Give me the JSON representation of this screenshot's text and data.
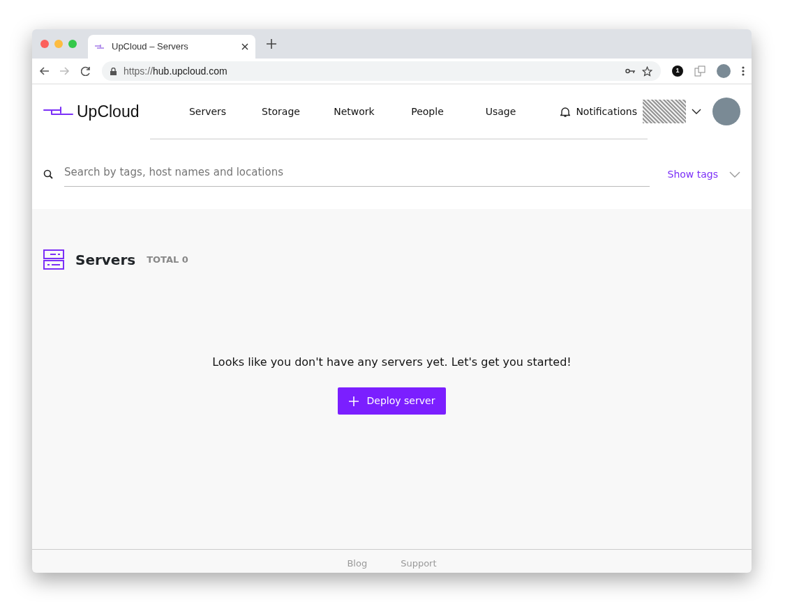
{
  "browser": {
    "tab_title": "UpCloud – Servers",
    "url_scheme": "https://",
    "url_host": "hub.upcloud.com",
    "extension_badge": "1"
  },
  "header": {
    "logo": "UpCloud",
    "nav": [
      {
        "label": "Servers"
      },
      {
        "label": "Storage"
      },
      {
        "label": "Network"
      },
      {
        "label": "People"
      },
      {
        "label": "Usage"
      }
    ],
    "notifications": "Notifications"
  },
  "search": {
    "placeholder": "Search by tags, host names and locations",
    "show_tags": "Show tags"
  },
  "servers": {
    "title": "Servers",
    "total": "TOTAL 0",
    "empty_message": "Looks like you don't have any servers yet. Let's get you started!",
    "deploy_button": "Deploy server"
  },
  "footer": {
    "links": [
      "Blog",
      "Support"
    ]
  }
}
